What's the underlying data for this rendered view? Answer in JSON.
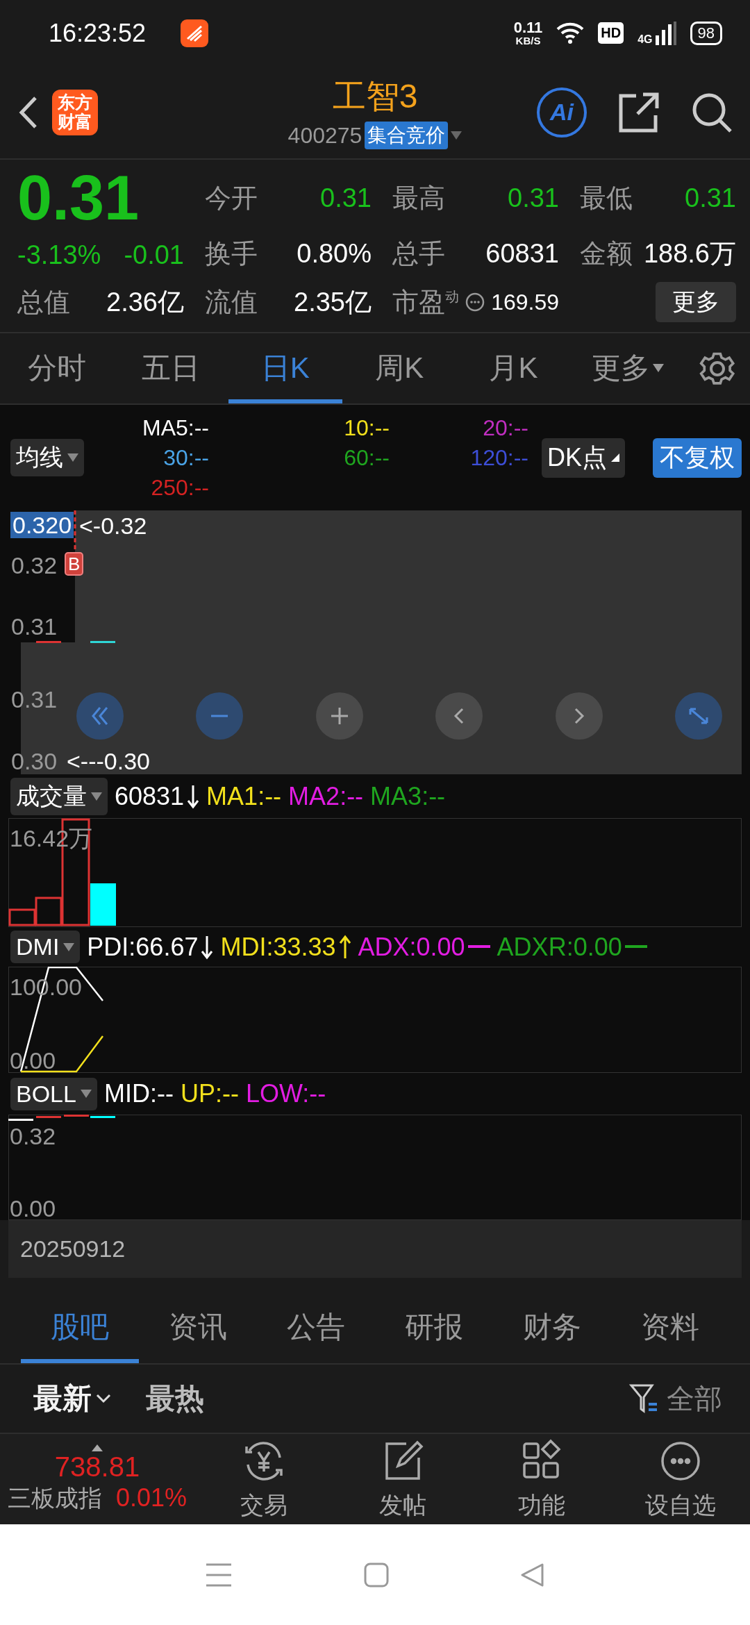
{
  "status_bar": {
    "time": "16:23:52",
    "net_speed": "0.11",
    "net_unit": "KB/S",
    "hd": "HD",
    "network": "4G",
    "battery": "98"
  },
  "header": {
    "logo_lines": [
      "东方",
      "财富"
    ],
    "title": "工智3",
    "code": "400275",
    "badge": "集合竞价",
    "ai_label": "Ai"
  },
  "quote": {
    "price": "0.31",
    "change_pct": "-3.13%",
    "change": "-0.01",
    "stats": [
      {
        "label": "今开",
        "value": "0.31",
        "kind": "down"
      },
      {
        "label": "最高",
        "value": "0.31",
        "kind": "down"
      },
      {
        "label": "最低",
        "value": "0.31",
        "kind": "down"
      },
      {
        "label": "换手",
        "value": "0.80%",
        "kind": "plain"
      },
      {
        "label": "总手",
        "value": "60831",
        "kind": "plain"
      },
      {
        "label": "金额",
        "value": "188.6万",
        "kind": "plain"
      },
      {
        "label": "总值",
        "value": "2.36亿",
        "kind": "plain"
      },
      {
        "label": "流值",
        "value": "2.35亿",
        "kind": "plain"
      },
      {
        "label": "市盈",
        "sup": "动",
        "value": "169.59",
        "kind": "small"
      }
    ],
    "more": "更多"
  },
  "chart_tabs": [
    {
      "label": "分时",
      "selected": false,
      "kind": "plain"
    },
    {
      "label": "五日",
      "selected": false,
      "kind": "plain"
    },
    {
      "label": "日K",
      "selected": true,
      "kind": "plain"
    },
    {
      "label": "周K",
      "selected": false,
      "kind": "plain"
    },
    {
      "label": "月K",
      "selected": false,
      "kind": "plain"
    },
    {
      "label": "更多",
      "selected": false,
      "kind": "menu"
    }
  ],
  "ma_bar": {
    "selector": "均线",
    "legend": [
      {
        "text": "MA5:--",
        "color": "#ffffff"
      },
      {
        "text": "10:--",
        "color": "#f2e01c"
      },
      {
        "text": "20:--",
        "color": "#c02ec0"
      },
      {
        "text": "30:--",
        "color": "#4aa3e6"
      },
      {
        "text": "60:--",
        "color": "#1fa51f"
      },
      {
        "text": "120:--",
        "color": "#3d4ed6"
      },
      {
        "text": "250:--",
        "color": "#d42222"
      }
    ],
    "dk": "DK点",
    "adjust": "不复权"
  },
  "main_chart": {
    "cursor_price": "0.320",
    "top_marker": "<-0.32",
    "bottom_marker": "<---0.30",
    "axis": [
      "0.32",
      "0.31",
      "0.31",
      "0.30"
    ],
    "buy_badge": "B"
  },
  "volume": {
    "selector": "成交量",
    "legend": [
      {
        "text": "60831",
        "color": "#ffffff",
        "kind": "down"
      },
      {
        "text": "MA1:--",
        "color": "#f2e01c",
        "kind": "plain"
      },
      {
        "text": "MA2:--",
        "color": "#e21de2",
        "kind": "plain"
      },
      {
        "text": "MA3:--",
        "color": "#1fa51f",
        "kind": "plain"
      }
    ],
    "axis_max": "16.42万"
  },
  "dmi": {
    "selector": "DMI",
    "legend": [
      {
        "text": "PDI:66.67",
        "color": "#ffffff",
        "kind": "down"
      },
      {
        "text": "MDI:33.33",
        "color": "#f2e01c",
        "kind": "up"
      },
      {
        "text": "ADX:0.00",
        "color": "#e21de2",
        "kind": "flat"
      },
      {
        "text": "ADXR:0.00",
        "color": "#1fa51f",
        "kind": "flat"
      }
    ],
    "axis_max": "100.00",
    "axis_min": "0.00"
  },
  "boll": {
    "selector": "BOLL",
    "legend": [
      {
        "text": "MID:--",
        "color": "#ffffff"
      },
      {
        "text": "UP:--",
        "color": "#f2e01c"
      },
      {
        "text": "LOW:--",
        "color": "#e21de2"
      }
    ],
    "axis_max": "0.32",
    "axis_min": "0.00"
  },
  "date": "20250912",
  "content_tabs": [
    {
      "label": "股吧",
      "selected": true
    },
    {
      "label": "资讯",
      "selected": false
    },
    {
      "label": "公告",
      "selected": false
    },
    {
      "label": "研报",
      "selected": false
    },
    {
      "label": "财务",
      "selected": false
    },
    {
      "label": "资料",
      "selected": false
    }
  ],
  "sort": [
    {
      "label": "最新",
      "selected": true,
      "kind": "menu"
    },
    {
      "label": "最热",
      "selected": false,
      "kind": "plain"
    }
  ],
  "filter": "全部",
  "index": {
    "value": "738.81",
    "name": "三板成指",
    "change": "0.01%",
    "kind": "up"
  },
  "nav": [
    {
      "label": "交易",
      "kind": "trade"
    },
    {
      "label": "发帖",
      "kind": "post"
    },
    {
      "label": "功能",
      "kind": "apps"
    },
    {
      "label": "设自选",
      "kind": "more"
    }
  ]
}
